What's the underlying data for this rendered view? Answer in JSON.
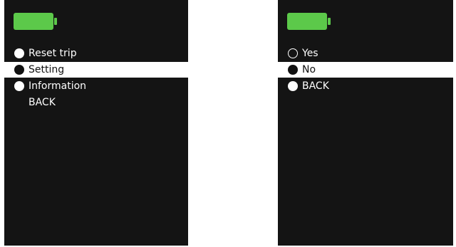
{
  "left_screen": {
    "battery_color": "#5cc94a",
    "menu": [
      {
        "label": "Reset trip",
        "bullet": "filled-white",
        "selected": false
      },
      {
        "label": "Setting",
        "bullet": "filled-black",
        "selected": true
      },
      {
        "label": "Information",
        "bullet": "filled-white",
        "selected": false
      },
      {
        "label": "BACK",
        "bullet": "none",
        "selected": false
      }
    ]
  },
  "right_screen": {
    "battery_color": "#5cc94a",
    "menu": [
      {
        "label": "Yes",
        "bullet": "hollow",
        "selected": false
      },
      {
        "label": "No",
        "bullet": "filled-black",
        "selected": true
      },
      {
        "label": "BACK",
        "bullet": "filled-white",
        "selected": false
      }
    ]
  }
}
